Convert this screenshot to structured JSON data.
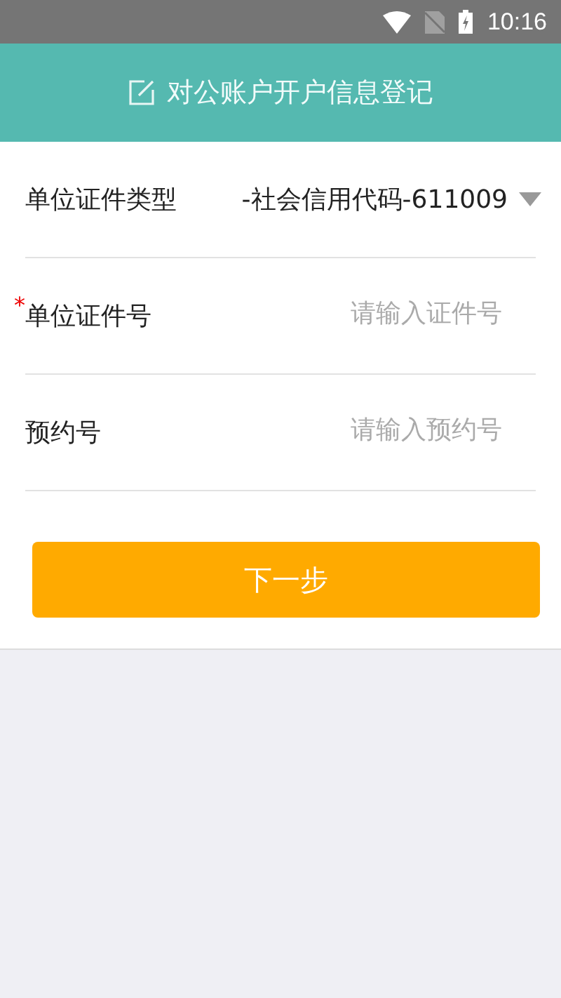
{
  "status_bar": {
    "time": "10:16"
  },
  "header": {
    "title": "对公账户开户信息登记"
  },
  "fields": [
    {
      "kind": "select",
      "label": "单位证件类型",
      "value": "-社会信用代码-611009"
    },
    {
      "kind": "input",
      "label": "单位证件号",
      "required_mark": "*",
      "placeholder": "请输入证件号"
    },
    {
      "kind": "input",
      "label": "预约号",
      "placeholder": "请输入预约号"
    }
  ],
  "next_button": "下一步"
}
